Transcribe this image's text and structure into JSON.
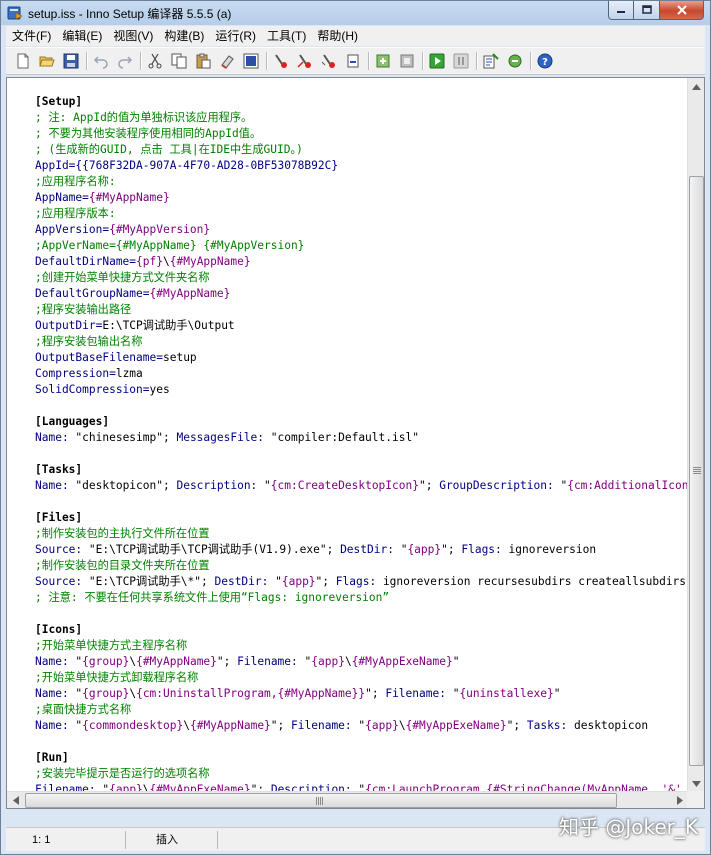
{
  "window": {
    "title": "setup.iss - Inno Setup 编译器 5.5.5 (a)"
  },
  "menu": [
    "文件(F)",
    "编辑(E)",
    "视图(V)",
    "构建(B)",
    "运行(R)",
    "工具(T)",
    "帮助(H)"
  ],
  "toolbar": {
    "icons": [
      "new-file-icon",
      "open-file-icon",
      "save-icon",
      "undo-icon",
      "redo-icon",
      "cut-icon",
      "copy-icon",
      "paste-icon",
      "clear-icon",
      "select-all-icon",
      "insert-line-icon",
      "delete-line-icon",
      "prev-line-icon",
      "next-line-icon",
      "compile-icon",
      "stop-compile-icon",
      "run-icon",
      "pause-icon",
      "wizard-icon",
      "tools-icon",
      "help-icon"
    ]
  },
  "editor": {
    "lines": [
      [
        {
          "t": "[Setup]",
          "c": "sec"
        }
      ],
      [
        {
          "t": "; 注: AppId的值为单独标识该应用程序。",
          "c": "c"
        }
      ],
      [
        {
          "t": "; 不要为其他安装程序使用相同的AppId值。",
          "c": "c"
        }
      ],
      [
        {
          "t": "; (生成新的GUID, 点击 工具|在IDE中生成GUID。)",
          "c": "c"
        }
      ],
      [
        {
          "t": "AppId={{768F32DA-907A-4F70-AD28-0BF53078B92C}",
          "c": "k"
        }
      ],
      [
        {
          "t": ";应用程序名称:",
          "c": "c"
        }
      ],
      [
        {
          "t": "AppName=",
          "c": "k"
        },
        {
          "t": "{#MyAppName}",
          "c": "p"
        }
      ],
      [
        {
          "t": ";应用程序版本:",
          "c": "c"
        }
      ],
      [
        {
          "t": "AppVersion=",
          "c": "k"
        },
        {
          "t": "{#MyAppVersion}",
          "c": "p"
        }
      ],
      [
        {
          "t": ";AppVerName={#MyAppName} {#MyAppVersion}",
          "c": "c"
        }
      ],
      [
        {
          "t": "DefaultDirName=",
          "c": "k"
        },
        {
          "t": "{pf}",
          "c": "p"
        },
        {
          "t": "\\",
          "c": "t"
        },
        {
          "t": "{#MyAppName}",
          "c": "p"
        }
      ],
      [
        {
          "t": ";创建开始菜单快捷方式文件夹名称",
          "c": "c"
        }
      ],
      [
        {
          "t": "DefaultGroupName=",
          "c": "k"
        },
        {
          "t": "{#MyAppName}",
          "c": "p"
        }
      ],
      [
        {
          "t": ";程序安装输出路径",
          "c": "c"
        }
      ],
      [
        {
          "t": "OutputDir=",
          "c": "k"
        },
        {
          "t": "E:\\TCP调试助手\\Output",
          "c": "t"
        }
      ],
      [
        {
          "t": ";程序安装包输出名称",
          "c": "c"
        }
      ],
      [
        {
          "t": "OutputBaseFilename=",
          "c": "k"
        },
        {
          "t": "setup",
          "c": "t"
        }
      ],
      [
        {
          "t": "Compression=",
          "c": "k"
        },
        {
          "t": "lzma",
          "c": "t"
        }
      ],
      [
        {
          "t": "SolidCompression=",
          "c": "k"
        },
        {
          "t": "yes",
          "c": "t"
        }
      ],
      [],
      [
        {
          "t": "[Languages]",
          "c": "sec"
        }
      ],
      [
        {
          "t": "Name: ",
          "c": "k"
        },
        {
          "t": "\"chinesesimp\"",
          "c": "s"
        },
        {
          "t": "; ",
          "c": "t"
        },
        {
          "t": "MessagesFile: ",
          "c": "k"
        },
        {
          "t": "\"compiler:Default.isl\"",
          "c": "s"
        }
      ],
      [],
      [
        {
          "t": "[Tasks]",
          "c": "sec"
        }
      ],
      [
        {
          "t": "Name: ",
          "c": "k"
        },
        {
          "t": "\"desktopicon\"",
          "c": "s"
        },
        {
          "t": "; ",
          "c": "t"
        },
        {
          "t": "Description: ",
          "c": "k"
        },
        {
          "t": "\"",
          "c": "s"
        },
        {
          "t": "{cm:CreateDesktopIcon}",
          "c": "p"
        },
        {
          "t": "\"",
          "c": "s"
        },
        {
          "t": "; ",
          "c": "t"
        },
        {
          "t": "GroupDescription: ",
          "c": "k"
        },
        {
          "t": "\"",
          "c": "s"
        },
        {
          "t": "{cm:AdditionalIcons}",
          "c": "p"
        }
      ],
      [],
      [
        {
          "t": "[Files]",
          "c": "sec"
        }
      ],
      [
        {
          "t": ";制作安装包的主执行文件所在位置",
          "c": "c"
        }
      ],
      [
        {
          "t": "Source: ",
          "c": "k"
        },
        {
          "t": "\"E:\\TCP调试助手\\TCP调试助手(V1.9).exe\"",
          "c": "s"
        },
        {
          "t": "; ",
          "c": "t"
        },
        {
          "t": "DestDir: ",
          "c": "k"
        },
        {
          "t": "\"",
          "c": "s"
        },
        {
          "t": "{app}",
          "c": "p"
        },
        {
          "t": "\"",
          "c": "s"
        },
        {
          "t": "; ",
          "c": "t"
        },
        {
          "t": "Flags: ",
          "c": "k"
        },
        {
          "t": "ignoreversion",
          "c": "t"
        }
      ],
      [
        {
          "t": ";制作安装包的目录文件夹所在位置",
          "c": "c"
        }
      ],
      [
        {
          "t": "Source: ",
          "c": "k"
        },
        {
          "t": "\"E:\\TCP调试助手\\*\"",
          "c": "s"
        },
        {
          "t": "; ",
          "c": "t"
        },
        {
          "t": "DestDir: ",
          "c": "k"
        },
        {
          "t": "\"",
          "c": "s"
        },
        {
          "t": "{app}",
          "c": "p"
        },
        {
          "t": "\"",
          "c": "s"
        },
        {
          "t": "; ",
          "c": "t"
        },
        {
          "t": "Flags: ",
          "c": "k"
        },
        {
          "t": "ignoreversion recursesubdirs createallsubdirs",
          "c": "t"
        }
      ],
      [
        {
          "t": "; 注意: 不要在任何共享系统文件上使用“Flags: ignoreversion”",
          "c": "c"
        }
      ],
      [],
      [
        {
          "t": "[Icons]",
          "c": "sec"
        }
      ],
      [
        {
          "t": ";开始菜单快捷方式主程序名称",
          "c": "c"
        }
      ],
      [
        {
          "t": "Name: ",
          "c": "k"
        },
        {
          "t": "\"",
          "c": "s"
        },
        {
          "t": "{group}",
          "c": "p"
        },
        {
          "t": "\\",
          "c": "s"
        },
        {
          "t": "{#MyAppName}",
          "c": "p"
        },
        {
          "t": "\"",
          "c": "s"
        },
        {
          "t": "; ",
          "c": "t"
        },
        {
          "t": "Filename: ",
          "c": "k"
        },
        {
          "t": "\"",
          "c": "s"
        },
        {
          "t": "{app}",
          "c": "p"
        },
        {
          "t": "\\",
          "c": "s"
        },
        {
          "t": "{#MyAppExeName}",
          "c": "p"
        },
        {
          "t": "\"",
          "c": "s"
        }
      ],
      [
        {
          "t": ";开始菜单快捷方式卸载程序名称",
          "c": "c"
        }
      ],
      [
        {
          "t": "Name: ",
          "c": "k"
        },
        {
          "t": "\"",
          "c": "s"
        },
        {
          "t": "{group}",
          "c": "p"
        },
        {
          "t": "\\",
          "c": "s"
        },
        {
          "t": "{cm:UninstallProgram,{#MyAppName}}",
          "c": "p"
        },
        {
          "t": "\"",
          "c": "s"
        },
        {
          "t": "; ",
          "c": "t"
        },
        {
          "t": "Filename: ",
          "c": "k"
        },
        {
          "t": "\"",
          "c": "s"
        },
        {
          "t": "{uninstallexe}",
          "c": "p"
        },
        {
          "t": "\"",
          "c": "s"
        }
      ],
      [
        {
          "t": ";桌面快捷方式名称",
          "c": "c"
        }
      ],
      [
        {
          "t": "Name: ",
          "c": "k"
        },
        {
          "t": "\"",
          "c": "s"
        },
        {
          "t": "{commondesktop}",
          "c": "p"
        },
        {
          "t": "\\",
          "c": "s"
        },
        {
          "t": "{#MyAppName}",
          "c": "p"
        },
        {
          "t": "\"",
          "c": "s"
        },
        {
          "t": "; ",
          "c": "t"
        },
        {
          "t": "Filename: ",
          "c": "k"
        },
        {
          "t": "\"",
          "c": "s"
        },
        {
          "t": "{app}",
          "c": "p"
        },
        {
          "t": "\\",
          "c": "s"
        },
        {
          "t": "{#MyAppExeName}",
          "c": "p"
        },
        {
          "t": "\"",
          "c": "s"
        },
        {
          "t": "; ",
          "c": "t"
        },
        {
          "t": "Tasks: ",
          "c": "k"
        },
        {
          "t": "desktopicon",
          "c": "t"
        }
      ],
      [],
      [
        {
          "t": "[Run]",
          "c": "sec"
        }
      ],
      [
        {
          "t": ";安装完毕提示是否运行的选项名称",
          "c": "c"
        }
      ],
      [
        {
          "t": "Filename: ",
          "c": "k"
        },
        {
          "t": "\"",
          "c": "s"
        },
        {
          "t": "{app}",
          "c": "p"
        },
        {
          "t": "\\",
          "c": "s"
        },
        {
          "t": "{#MyAppExeName}",
          "c": "p"
        },
        {
          "t": "\"",
          "c": "s"
        },
        {
          "t": "; ",
          "c": "t"
        },
        {
          "t": "Description: ",
          "c": "k"
        },
        {
          "t": "\"",
          "c": "s"
        },
        {
          "t": "{cm:LaunchProgram,{#StringChange(MyAppName, '&', '&&')}}",
          "c": "p"
        }
      ]
    ]
  },
  "status": {
    "position": "1:  1",
    "mode": "插入"
  },
  "watermark": "知乎 @Joker_K"
}
